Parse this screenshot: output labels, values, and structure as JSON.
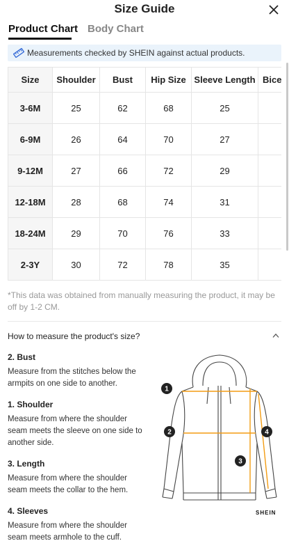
{
  "header": {
    "title": "Size Guide"
  },
  "tabs": [
    {
      "label": "Product Chart",
      "active": true
    },
    {
      "label": "Body Chart",
      "active": false
    }
  ],
  "notice": {
    "text": "Measurements checked by SHEIN against actual products.",
    "icon": "ruler-icon",
    "background": "#eaf3fb"
  },
  "table": {
    "headers": [
      "Size",
      "Shoulder",
      "Bust",
      "Hip Size",
      "Sleeve Length",
      "Bice"
    ],
    "rows": [
      [
        "3-6M",
        "25",
        "62",
        "68",
        "25",
        ""
      ],
      [
        "6-9M",
        "26",
        "64",
        "70",
        "27",
        ""
      ],
      [
        "9-12M",
        "27",
        "66",
        "72",
        "29",
        ""
      ],
      [
        "12-18M",
        "28",
        "68",
        "74",
        "31",
        ""
      ],
      [
        "18-24M",
        "29",
        "70",
        "76",
        "33",
        ""
      ],
      [
        "2-3Y",
        "30",
        "72",
        "78",
        "35",
        ""
      ]
    ]
  },
  "footnote": "*This data was obtained from manually measuring the product, it may be off by 1-2 CM.",
  "how_to": {
    "title": "How to measure the product's size?",
    "items": [
      {
        "title": "2. Bust",
        "desc": "Measure from the stitches below the armpits on one side to another."
      },
      {
        "title": "1. Shoulder",
        "desc": "Measure from where the shoulder seam meets the sleeve on one side to another side."
      },
      {
        "title": "3. Length",
        "desc": "Measure from where the shoulder seam meets the collar to the hem."
      },
      {
        "title": "4. Sleeves",
        "desc": "Measure from where the shoulder seam meets armhole to the cuff."
      }
    ],
    "markers": [
      "1",
      "2",
      "3",
      "4"
    ],
    "brand": "SHEIN",
    "accent": "#f39c12"
  }
}
